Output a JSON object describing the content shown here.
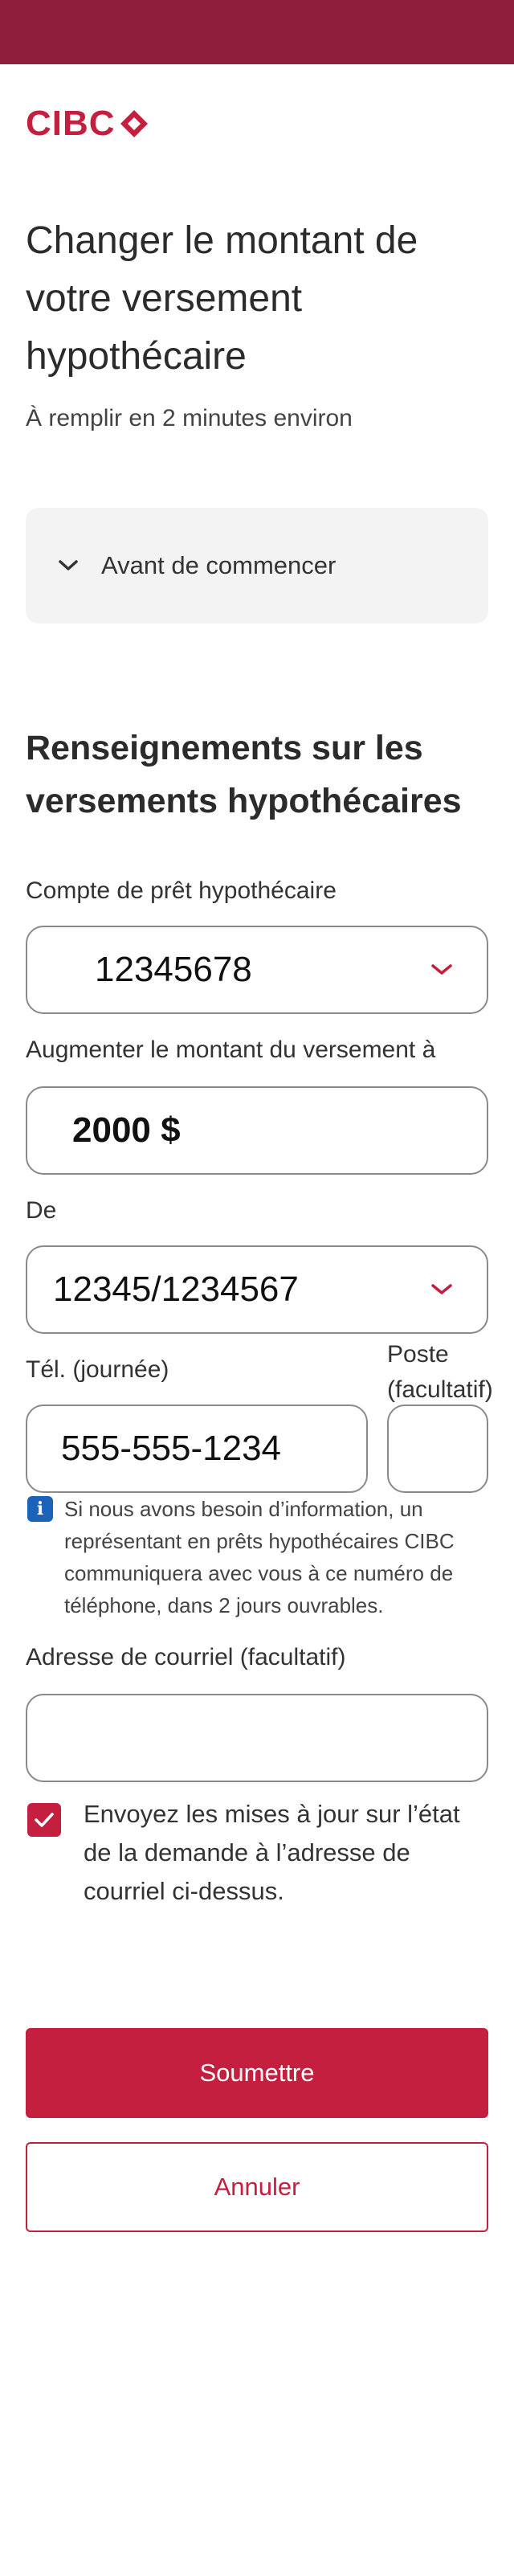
{
  "brand": {
    "name": "CIBC",
    "color": "#c41f3e",
    "bar_color": "#8f1d3c"
  },
  "page": {
    "title": "Changer le montant de votre versement hypothécaire",
    "subtitle": "À remplir en 2 minutes environ"
  },
  "accordion": {
    "label": "Avant de commencer",
    "icon": "chevron-down-icon"
  },
  "section": {
    "title": "Renseignements sur les versements hypothécaires"
  },
  "form": {
    "mortgage_account": {
      "label": "Compte de prêt hypothécaire",
      "value": "12345678"
    },
    "increase_amount": {
      "label": "Augmenter le montant du versement à",
      "value": "2000 $"
    },
    "from_account": {
      "label": "De",
      "value": "12345/1234567"
    },
    "phone": {
      "label": "Tél. (journée)",
      "value": "555-555-1234"
    },
    "extension": {
      "label": "Poste (facultatif)",
      "value": ""
    },
    "info": "Si nous avons besoin d’information, un représentant en prêts hypothécaires CIBC communiquera avec vous à ce numéro de téléphone, dans 2 jours ouvrables.",
    "email": {
      "label": "Adresse de courriel (facultatif)",
      "value": ""
    },
    "send_updates": {
      "label": "Envoyez les mises à jour sur l’état de la demande à l’adresse de courriel ci-dessus.",
      "checked": true
    }
  },
  "buttons": {
    "submit": "Soumettre",
    "cancel": "Annuler"
  }
}
